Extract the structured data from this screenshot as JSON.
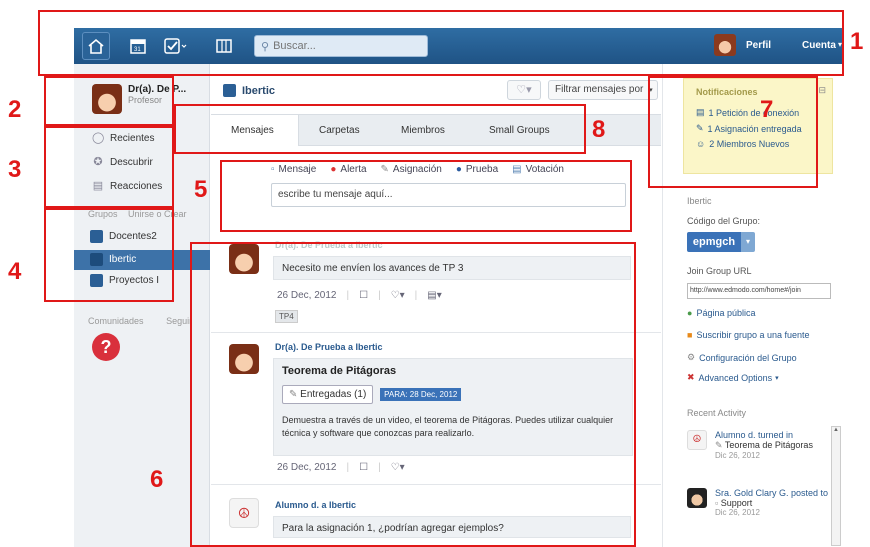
{
  "topbar": {
    "search_placeholder": "Buscar...",
    "profile_label": "Perfil",
    "account_label": "Cuenta"
  },
  "sidebar": {
    "user_name": "Dr(a). De P...",
    "user_role": "Profesor",
    "nav": [
      {
        "label": "Recientes"
      },
      {
        "label": "Descubrir"
      },
      {
        "label": "Reacciones"
      }
    ],
    "groups_label": "Grupos",
    "join_label": "Unirse o Crear",
    "groups": [
      {
        "label": "Docentes2"
      },
      {
        "label": "Ibertic"
      },
      {
        "label": "Proyectos I"
      }
    ],
    "communities_label": "Comunidades",
    "follow_label": "Seguir"
  },
  "main": {
    "group_name": "Ibertic",
    "filter_label": "Filtrar mensajes por",
    "tabs": [
      {
        "label": "Mensajes"
      },
      {
        "label": "Carpetas"
      },
      {
        "label": "Miembros"
      },
      {
        "label": "Small Groups"
      }
    ],
    "post_types": [
      {
        "label": "Mensaje"
      },
      {
        "label": "Alerta"
      },
      {
        "label": "Asignación"
      },
      {
        "label": "Prueba"
      },
      {
        "label": "Votación"
      }
    ],
    "composer_placeholder": "escribe tu mensaje aquí...",
    "posts": [
      {
        "author": "Dr(a). De Prueba a Ibertic",
        "body": "Necesito me envíen los avances de TP 3",
        "date": "26 Dec, 2012",
        "tag": "TP4"
      },
      {
        "author": "Dr(a). De Prueba a Ibertic",
        "title": "Teorema de Pitágoras",
        "delivered": "Entregadas (1)",
        "para": "PARA: 28 Dec, 2012",
        "body": "Demuestra a través de un video, el teorema de Pitágoras. Puedes utilizar cualquier técnica y software que conozcas para realizarlo.",
        "date": "26 Dec, 2012"
      },
      {
        "author": "Alumno d. a Ibertic",
        "body": "Para la asignación 1, ¿podrían agregar ejemplos?"
      }
    ]
  },
  "right": {
    "notifications_title": "Notificaciones",
    "notifications": [
      {
        "label": "1 Petición de conexión"
      },
      {
        "label": "1 Asignación entregada"
      },
      {
        "label": "2 Miembros Nuevos"
      }
    ],
    "group_header": "Ibertic",
    "code_label": "Código del Grupo:",
    "code_value": "epmgch",
    "join_url_label": "Join Group URL",
    "join_url_value": "http://www.edmodo.com/home#/join",
    "links": [
      {
        "label": "Página pública"
      },
      {
        "label": "Suscribir grupo a una fuente"
      },
      {
        "label": "Configuración del Grupo"
      },
      {
        "label": "Advanced Options"
      }
    ],
    "recent_activity_label": "Recent Activity",
    "activity": [
      {
        "who": "Alumno d. turned in",
        "what": "Teorema de Pitágoras",
        "date": "Dic 26, 2012"
      },
      {
        "who": "Sra. Gold Clary G. posted to",
        "what": "Support",
        "date": "Dic 26, 2012"
      }
    ]
  },
  "annotations": [
    {
      "number": "1"
    },
    {
      "number": "2"
    },
    {
      "number": "3"
    },
    {
      "number": "4"
    },
    {
      "number": "5"
    },
    {
      "number": "6"
    },
    {
      "number": "7"
    },
    {
      "number": "8"
    }
  ],
  "colors": {
    "topbar": "#1f5385",
    "accent": "#3a72b8",
    "annotation_red": "#e01818",
    "notification_bg": "#fbf6c8"
  }
}
